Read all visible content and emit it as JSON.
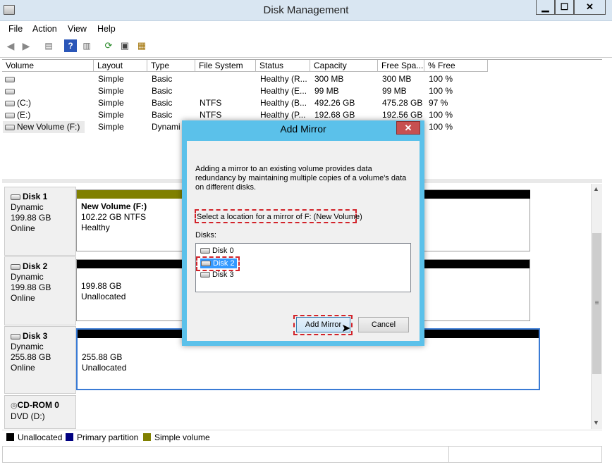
{
  "window": {
    "title": "Disk Management",
    "min": "▁",
    "max": "☐",
    "close": "✕"
  },
  "menu": [
    "File",
    "Action",
    "View",
    "Help"
  ],
  "toolbar_icons": [
    "back-icon",
    "forward-icon",
    "properties-pane-icon",
    "help-icon",
    "show-pane-icon",
    "refresh-icon",
    "rescan-icon",
    "settings-icon"
  ],
  "columns": [
    "Volume",
    "Layout",
    "Type",
    "File System",
    "Status",
    "Capacity",
    "Free Spa...",
    "% Free"
  ],
  "volumes": [
    [
      "",
      "Simple",
      "Basic",
      "",
      "Healthy (R...",
      "300 MB",
      "300 MB",
      "100 %"
    ],
    [
      "",
      "Simple",
      "Basic",
      "",
      "Healthy (E...",
      "99 MB",
      "99 MB",
      "100 %"
    ],
    [
      "(C:)",
      "Simple",
      "Basic",
      "NTFS",
      "Healthy (B...",
      "492.26 GB",
      "475.28 GB",
      "97 %"
    ],
    [
      "(E:)",
      "Simple",
      "Basic",
      "NTFS",
      "Healthy (P...",
      "192.68 GB",
      "192.56 GB",
      "100 %"
    ],
    [
      "New Volume (F:)",
      "Simple",
      "Dynami",
      "",
      "",
      "",
      "",
      "100 %"
    ]
  ],
  "disks": [
    {
      "name": "Disk 1",
      "type": "Dynamic",
      "size": "199.88 GB",
      "state": "Online",
      "part_title": "New Volume  (F:)",
      "part_line1": "102.22 GB NTFS",
      "part_line2": "Healthy"
    },
    {
      "name": "Disk 2",
      "type": "Dynamic",
      "size": "199.88 GB",
      "state": "Online",
      "part_line1": "199.88 GB",
      "part_line2": "Unallocated"
    },
    {
      "name": "Disk 3",
      "type": "Dynamic",
      "size": "255.88 GB",
      "state": "Online",
      "part_line1": "255.88 GB",
      "part_line2": "Unallocated"
    },
    {
      "name": "CD-ROM 0",
      "type": "DVD (D:)"
    }
  ],
  "legend": [
    {
      "label": "Unallocated",
      "color": "#000000"
    },
    {
      "label": "Primary partition",
      "color": "#000080"
    },
    {
      "label": "Simple volume",
      "color": "#808000"
    }
  ],
  "dialog": {
    "title": "Add Mirror",
    "close": "✕",
    "description": "Adding a mirror to an existing volume provides data redundancy by maintaining multiple copies of a volume's data on different disks.",
    "select_label": "Select a location for a mirror of F: (New Volume)",
    "disks_label": "Disks:",
    "disk_options": [
      "Disk 0",
      "Disk 2",
      "Disk 3"
    ],
    "selected": "Disk 2",
    "ok_button": "Add Mirror",
    "cancel_button": "Cancel"
  },
  "colors": {
    "accent": "#5bc1ea",
    "highlight": "#d2232a",
    "selection": "#3399ff"
  }
}
